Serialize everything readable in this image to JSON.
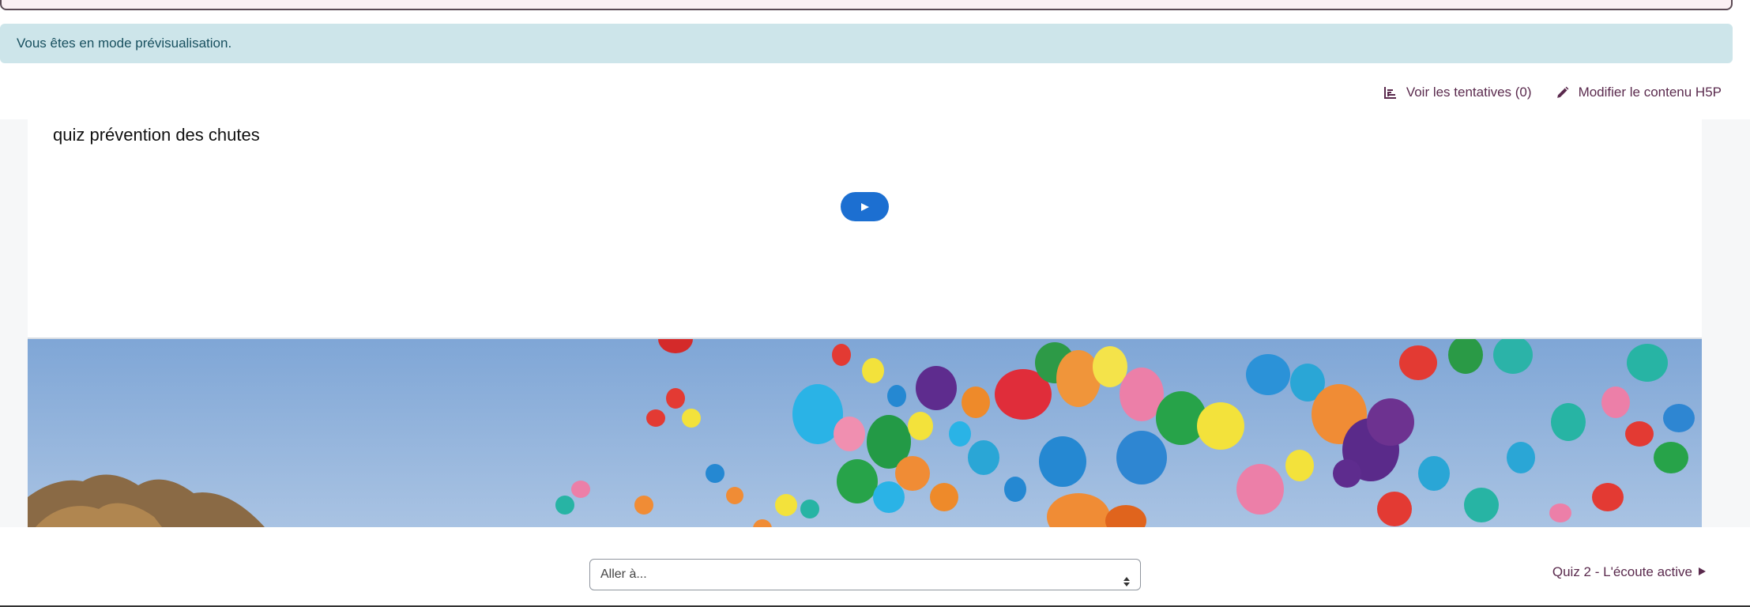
{
  "preview_alert": {
    "text": "Vous êtes en mode prévisualisation."
  },
  "actions": {
    "attempts_label": "Voir les tentatives (0)",
    "edit_label": "Modifier le contenu H5P"
  },
  "h5p": {
    "title": "quiz prévention des chutes",
    "play_icon": "play-icon",
    "image_subject": "balloons-in-sky"
  },
  "navigation": {
    "goto_placeholder": "Aller à...",
    "next_label": "Quiz 2 - L'écoute active"
  },
  "colors": {
    "alert_bg": "#cde5ea",
    "alert_text": "#18505f",
    "link": "#5a2a4d",
    "play_button": "#1c6fd1"
  }
}
